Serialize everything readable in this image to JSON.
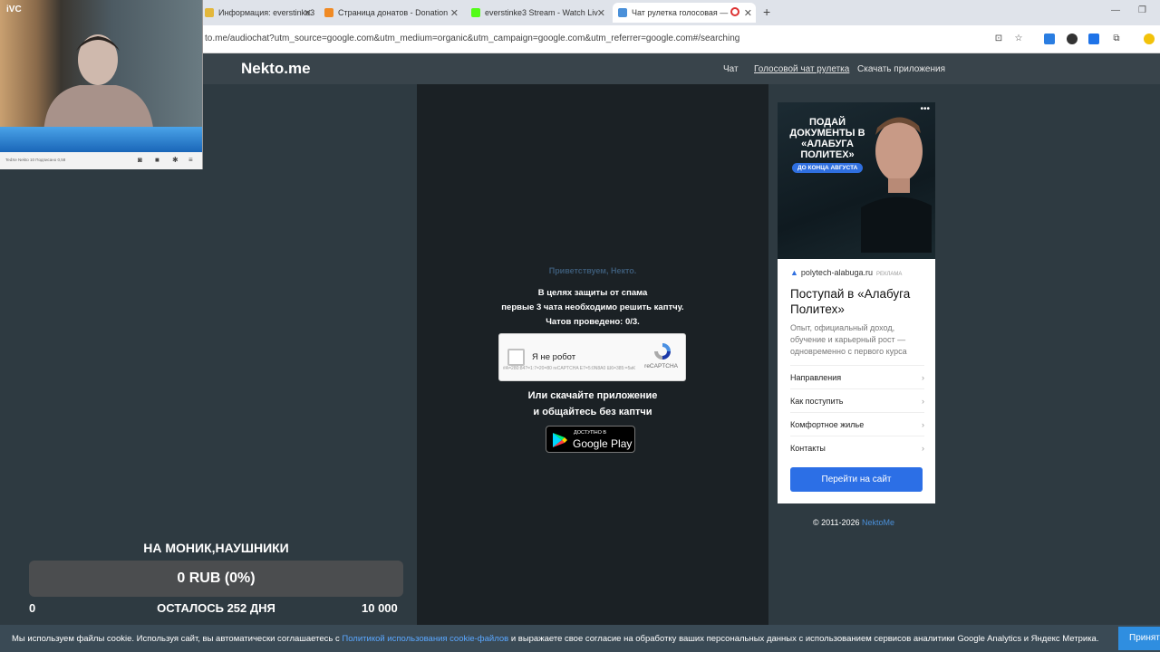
{
  "browser": {
    "tabs": [
      {
        "title": "Информация: everstinke3",
        "favicon_color": "#e3b73b"
      },
      {
        "title": "Страница донатов - Donation",
        "favicon_color": "#f08a24"
      },
      {
        "title": "everstinke3 Stream - Watch Liv",
        "favicon_color": "#53fc18"
      },
      {
        "title": "Чат рулетка голосовая — ",
        "favicon_color": "#4a90d9"
      }
    ],
    "new_tab": "+",
    "url": "to.me/audiochat?utm_source=google.com&utm_medium=organic&utm_campaign=google.com&utm_referrer=google.com#/searching"
  },
  "site": {
    "logo": "Nekto.me",
    "nav": [
      "Чат",
      "Голосовой чат рулетка",
      "Скачать приложения"
    ]
  },
  "center": {
    "greeting": "Приветствуем, Некто.",
    "spam_lines": [
      "В целях защиты от спама",
      "первые 3 чата необходимо решить каптчу.",
      "Чатов проведено: 0/3."
    ],
    "captcha_label": "Я не робот",
    "captcha_brand": "reCAPTCHA",
    "captcha_tiny": "#A=280:84?=1:7=20=80 reCAPTCHA\nE7=5:0N8A0 Ш6=385:=5иК",
    "app_lines": [
      "Или скачайте приложение",
      "и общайтесь без каптчи"
    ],
    "gplay_small": "ДОСТУПНО В",
    "gplay_big": "Google Play"
  },
  "ad": {
    "headline": "ПОДАЙ ДОКУМЕНТЫ В «АЛАБУГА ПОЛИТЕХ»",
    "badge": "ДО КОНЦА АВГУСТА",
    "dots": "•••",
    "domain": "polytech-alabuga.ru",
    "ad_label": "РЕКЛАМА",
    "title": "Поступай в «Алабуга Политех»",
    "desc": "Опыт, официальный доход, обучение и карьерный рост — одновременно с первого курса",
    "links": [
      "Направления",
      "Как поступить",
      "Комфортное жилье",
      "Контакты"
    ],
    "button": "Перейти на сайт"
  },
  "footer": {
    "copyright": "© 2011-2026 ",
    "copyright_link": "NektoMe"
  },
  "webcam": {
    "tag": "iVC",
    "bar_text": "TedXe Nekto 10 Подписано 0,58"
  },
  "donation": {
    "title": "НА МОНИК,НАУШНИКИ",
    "amount": "0 RUB (0%)",
    "progress_fraction": 0,
    "min": "0",
    "remaining": "ОСТАЛОСЬ 252 ДНЯ",
    "max": "10 000"
  },
  "cookie": {
    "text_before": "Мы используем файлы cookie. Используя сайт, вы автоматически соглашаетесь с ",
    "link": "Политикой использования cookie-файлов",
    "text_after": " и выражаете свое согласие на обработку ваших персональных данных с использованием сервисов аналитики Google Analytics и Яндекс Метрика.",
    "accept": "Принять"
  }
}
